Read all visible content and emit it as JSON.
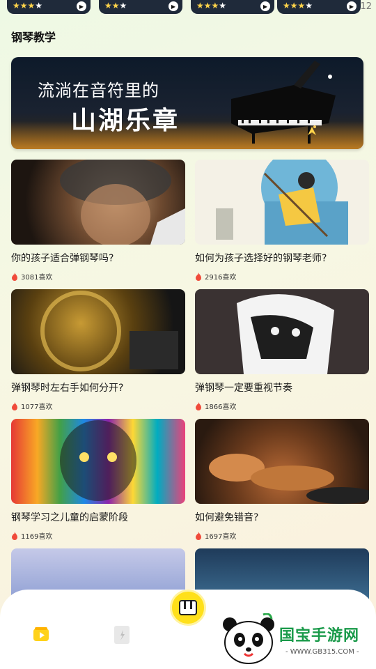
{
  "top_strip": {
    "cards": [
      {
        "stars": "★★★★",
        "filled": 3
      },
      {
        "stars": "★★★",
        "filled": 2
      },
      {
        "stars": "★★★★",
        "filled": 3
      },
      {
        "stars": "★★★★",
        "filled": 3
      }
    ],
    "partial_number": "12"
  },
  "section": {
    "title": "钢琴教学"
  },
  "banner": {
    "line1": "流淌在音符里的",
    "line2": "山湖乐章"
  },
  "colors": {
    "accent_yellow": "#ffe01a",
    "fire_red": "#f04a3a",
    "brand_green": "#1a9a4a"
  },
  "articles": [
    {
      "title": "你的孩子适合弹钢琴吗?",
      "likes": "3081喜欢"
    },
    {
      "title": "如何为孩子选择好的钢琴老师?",
      "likes": "2916喜欢"
    },
    {
      "title": "弹钢琴时左右手如何分开?",
      "likes": "1077喜欢"
    },
    {
      "title": "弹钢琴一定要重视节奏",
      "likes": "1866喜欢"
    },
    {
      "title": "钢琴学习之儿童的启蒙阶段",
      "likes": "1169喜欢"
    },
    {
      "title": "如何避免错音?",
      "likes": "1697喜欢"
    }
  ],
  "watermark": {
    "name": "国宝手游网",
    "url": "- WWW.GB315.COM -"
  }
}
